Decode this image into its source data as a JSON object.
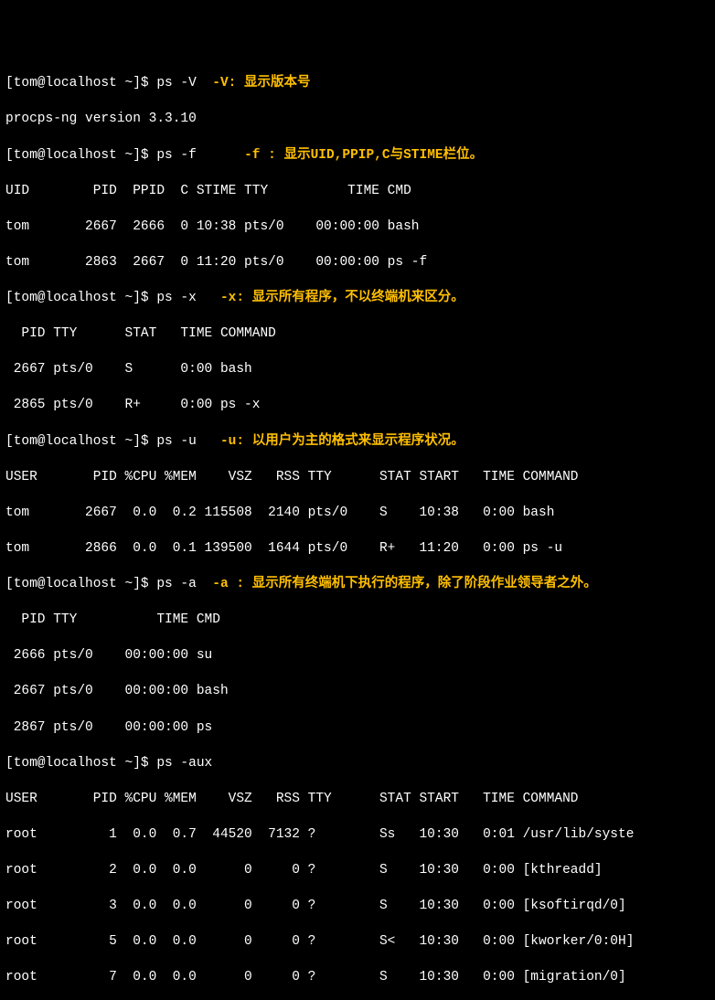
{
  "prompt": "[tom@localhost ~]$ ",
  "cmds": {
    "c1": "ps -V",
    "c2": "ps -f",
    "c3": "ps -x",
    "c4": "ps -u",
    "c5": "ps -a",
    "c6": "ps -aux"
  },
  "annotations": {
    "a1": "-V: 显示版本号",
    "a2": "-f : 显示UID,PPIP,C与STIME栏位。",
    "a3": "-x: 显示所有程序，不以终端机来区分。",
    "a4": "-u: 以用户为主的格式来显示程序状况。",
    "a5": "-a : 显示所有终端机下执行的程序，除了阶段作业领导者之外。"
  },
  "out_version": "procps-ng version 3.3.10",
  "out_f_header": "UID        PID  PPID  C STIME TTY          TIME CMD",
  "out_f_rows": [
    "tom       2667  2666  0 10:38 pts/0    00:00:00 bash",
    "tom       2863  2667  0 11:20 pts/0    00:00:00 ps -f"
  ],
  "out_x_header": "  PID TTY      STAT   TIME COMMAND",
  "out_x_rows": [
    " 2667 pts/0    S      0:00 bash",
    " 2865 pts/0    R+     0:00 ps -x"
  ],
  "out_u_header": "USER       PID %CPU %MEM    VSZ   RSS TTY      STAT START   TIME COMMAND",
  "out_u_rows": [
    "tom       2667  0.0  0.2 115508  2140 pts/0    S    10:38   0:00 bash",
    "tom       2866  0.0  0.1 139500  1644 pts/0    R+   11:20   0:00 ps -u"
  ],
  "out_a_header": "  PID TTY          TIME CMD",
  "out_a_rows": [
    " 2666 pts/0    00:00:00 su",
    " 2667 pts/0    00:00:00 bash",
    " 2867 pts/0    00:00:00 ps"
  ],
  "out_aux_header": "USER       PID %CPU %MEM    VSZ   RSS TTY      STAT START   TIME COMMAND",
  "out_aux_rows": [
    "root         1  0.0  0.7  44520  7132 ?        Ss   10:30   0:01 /usr/lib/syste",
    "root         2  0.0  0.0      0     0 ?        S    10:30   0:00 [kthreadd]",
    "root         3  0.0  0.0      0     0 ?        S    10:30   0:00 [ksoftirqd/0]",
    "root         5  0.0  0.0      0     0 ?        S<   10:30   0:00 [kworker/0:0H]",
    "root         7  0.0  0.0      0     0 ?        S    10:30   0:00 [migration/0]"
  ]
}
